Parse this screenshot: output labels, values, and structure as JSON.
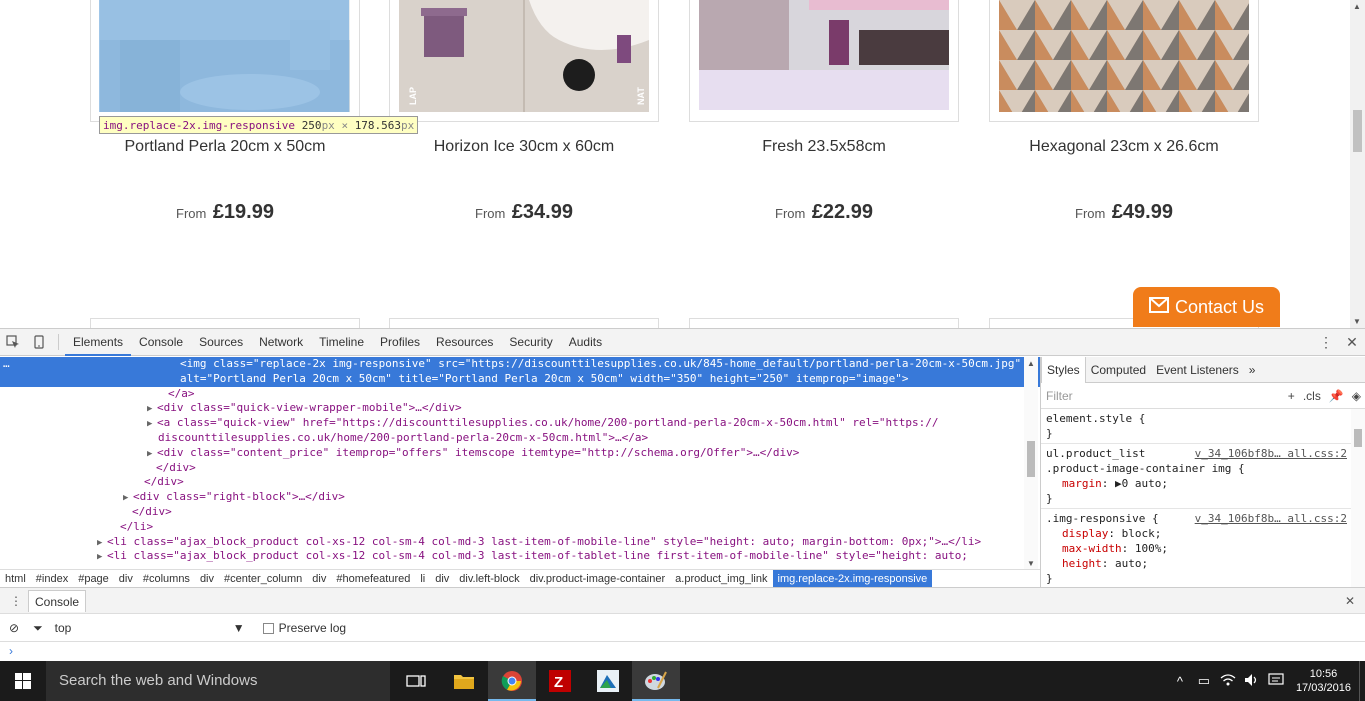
{
  "products": [
    {
      "name": "Portland Perla 20cm x 50cm",
      "from": "From",
      "price": "£19.99"
    },
    {
      "name": "Horizon Ice 30cm x 60cm",
      "from": "From",
      "price": "£34.99",
      "img_label_left": "LAP",
      "img_label_right": "NAT"
    },
    {
      "name": "Fresh 23.5x58cm",
      "from": "From",
      "price": "£22.99"
    },
    {
      "name": "Hexagonal 23cm x 26.6cm",
      "from": "From",
      "price": "£49.99"
    }
  ],
  "inspect_tooltip": {
    "selector": "img.replace-2x.img-responsive",
    "width": "250",
    "times": "×",
    "height": "178.563",
    "unit": "px"
  },
  "contact_button": {
    "label": "Contact Us",
    "icon": "envelope-icon",
    "color": "#f07c1a"
  },
  "devtools": {
    "tabs": [
      "Elements",
      "Console",
      "Sources",
      "Network",
      "Timeline",
      "Profiles",
      "Resources",
      "Security",
      "Audits"
    ],
    "active_tab": "Elements",
    "dom_lines": [
      {
        "text": "<img class=\"replace-2x img-responsive\" src=\"https://discounttilesupplies.co.uk/845-home_default/portland-perla-20cm-x-50cm.jpg\"",
        "selected": true
      },
      {
        "text": "alt=\"Portland Perla 20cm x 50cm\" title=\"Portland Perla 20cm x 50cm\" width=\"350\" height=\"250\" itemprop=\"image\">",
        "selected": true
      },
      {
        "text": "</a>"
      },
      {
        "text": "<div class=\"quick-view-wrapper-mobile\">…</div>",
        "tri": "▶"
      },
      {
        "text": "<a class=\"quick-view\" href=\"https://discounttilesupplies.co.uk/home/200-portland-perla-20cm-x-50cm.html\" rel=\"https://",
        "tri": "▶"
      },
      {
        "text": "discounttilesupplies.co.uk/home/200-portland-perla-20cm-x-50cm.html\">…</a>"
      },
      {
        "text": "<div class=\"content_price\" itemprop=\"offers\" itemscope itemtype=\"http://schema.org/Offer\">…</div>",
        "tri": "▶"
      },
      {
        "text": "</div>"
      },
      {
        "text": "</div>"
      },
      {
        "text": "<div class=\"right-block\">…</div>",
        "tri": "▶"
      },
      {
        "text": "</div>"
      },
      {
        "text": "</li>"
      },
      {
        "text": "<li class=\"ajax_block_product col-xs-12 col-sm-4 col-md-3 last-item-of-mobile-line\" style=\"height: auto; margin-bottom: 0px;\">…</li>",
        "tri": "▶"
      },
      {
        "text": "<li class=\"ajax_block_product col-xs-12 col-sm-4 col-md-3 last-item-of-tablet-line first-item-of-mobile-line\" style=\"height: auto;",
        "tri": "▶"
      }
    ],
    "selected_marker": "…",
    "breadcrumbs": [
      "html",
      "#index",
      "#page",
      "div",
      "#columns",
      "div",
      "#center_column",
      "div",
      "#homefeatured",
      "li",
      "div",
      "div.left-block",
      "div.product-image-container",
      "a.product_img_link",
      "img.replace-2x.img-responsive"
    ],
    "styles": {
      "tabs": [
        "Styles",
        "Computed",
        "Event Listeners",
        "»"
      ],
      "filter_placeholder": "Filter",
      "filter_cls": ".cls",
      "rules": [
        {
          "selector": "element.style {",
          "source": "",
          "props": [],
          "close": "}"
        },
        {
          "selector": "ul.product_list",
          "selector2": ".product-image-container img {",
          "source": "v_34_106bf8b… all.css:2",
          "props": [
            {
              "name": "margin",
              "value": "▶0 auto;"
            }
          ],
          "close": "}"
        },
        {
          "selector": ".img-responsive {",
          "source": "v_34_106bf8b… all.css:2",
          "props": [
            {
              "name": "display",
              "value": "block;"
            },
            {
              "name": "max-width",
              "value": "100%;"
            },
            {
              "name": "height",
              "value": "auto;"
            }
          ],
          "close": "}"
        }
      ]
    },
    "drawer": {
      "tab": "Console",
      "context": "top",
      "preserve_log": "Preserve log",
      "prompt": "›"
    }
  },
  "taskbar": {
    "search_placeholder": "Search the web and Windows",
    "apps": [
      "task-view",
      "file-explorer",
      "chrome",
      "filezilla",
      "app-blue",
      "paint"
    ],
    "time": "10:56",
    "date": "17/03/2016"
  }
}
